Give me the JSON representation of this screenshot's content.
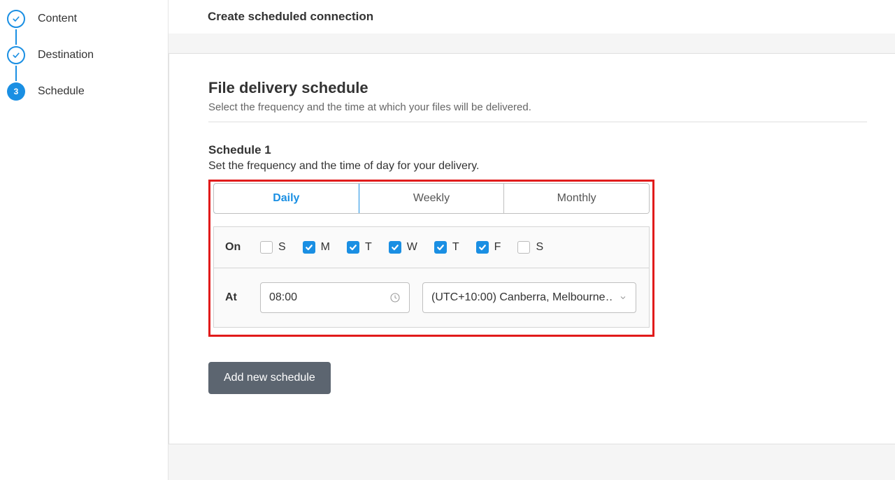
{
  "header": {
    "title": "Create scheduled connection"
  },
  "sidebar": {
    "steps": [
      {
        "label": "Content"
      },
      {
        "label": "Destination"
      },
      {
        "label": "Schedule",
        "current_number": "3"
      }
    ]
  },
  "section": {
    "title": "File delivery schedule",
    "subtitle": "Select the frequency and the time at which your files will be delivered."
  },
  "schedule": {
    "title": "Schedule 1",
    "subtitle": "Set the frequency and the time of day for your delivery.",
    "frequency": {
      "options": [
        "Daily",
        "Weekly",
        "Monthly"
      ],
      "active": "Daily"
    },
    "on_label": "On",
    "at_label": "At",
    "days": [
      {
        "abbr": "S",
        "checked": false
      },
      {
        "abbr": "M",
        "checked": true
      },
      {
        "abbr": "T",
        "checked": true
      },
      {
        "abbr": "W",
        "checked": true
      },
      {
        "abbr": "T",
        "checked": true
      },
      {
        "abbr": "F",
        "checked": true
      },
      {
        "abbr": "S",
        "checked": false
      }
    ],
    "time": "08:00",
    "timezone": "(UTC+10:00) Canberra, Melbourne…"
  },
  "actions": {
    "add_schedule": "Add new schedule"
  },
  "colors": {
    "accent": "#1a8fe3",
    "highlight": "#e11b1b",
    "button": "#5c6570"
  }
}
